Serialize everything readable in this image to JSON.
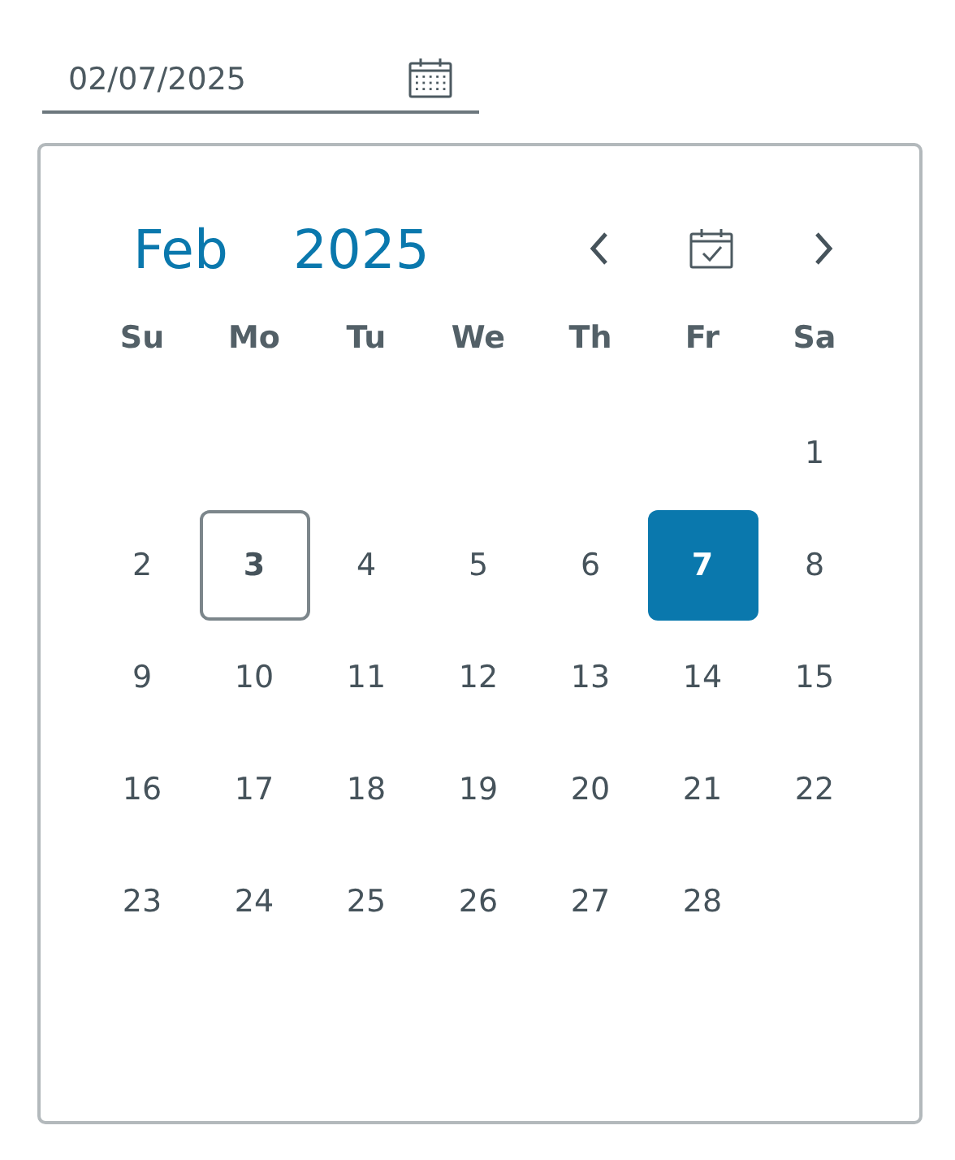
{
  "date_field": {
    "value": "02/07/2025"
  },
  "calendar": {
    "month": "Feb",
    "year": "2025",
    "weekdays": [
      "Su",
      "Mo",
      "Tu",
      "We",
      "Th",
      "Fr",
      "Sa"
    ],
    "weeks": [
      {
        "days": [
          {
            "label": "1",
            "selected": false,
            "today": false
          }
        ]
      },
      {
        "days": [
          {
            "label": "2",
            "selected": false,
            "today": false
          },
          {
            "label": "3",
            "selected": false,
            "today": true
          },
          {
            "label": "4",
            "selected": false,
            "today": false
          },
          {
            "label": "5",
            "selected": false,
            "today": false
          },
          {
            "label": "6",
            "selected": false,
            "today": false
          },
          {
            "label": "7",
            "selected": true,
            "today": false
          },
          {
            "label": "8",
            "selected": false,
            "today": false
          }
        ]
      },
      {
        "days": [
          {
            "label": "9",
            "selected": false,
            "today": false
          },
          {
            "label": "10",
            "selected": false,
            "today": false
          },
          {
            "label": "11",
            "selected": false,
            "today": false
          },
          {
            "label": "12",
            "selected": false,
            "today": false
          },
          {
            "label": "13",
            "selected": false,
            "today": false
          },
          {
            "label": "14",
            "selected": false,
            "today": false
          },
          {
            "label": "15",
            "selected": false,
            "today": false
          }
        ]
      },
      {
        "days": [
          {
            "label": "16",
            "selected": false,
            "today": false
          },
          {
            "label": "17",
            "selected": false,
            "today": false
          },
          {
            "label": "18",
            "selected": false,
            "today": false
          },
          {
            "label": "19",
            "selected": false,
            "today": false
          },
          {
            "label": "20",
            "selected": false,
            "today": false
          },
          {
            "label": "21",
            "selected": false,
            "today": false
          },
          {
            "label": "22",
            "selected": false,
            "today": false
          }
        ]
      },
      {
        "days": [
          {
            "label": "23",
            "selected": false,
            "today": false
          },
          {
            "label": "24",
            "selected": false,
            "today": false
          },
          {
            "label": "25",
            "selected": false,
            "today": false
          },
          {
            "label": "26",
            "selected": false,
            "today": false
          },
          {
            "label": "27",
            "selected": false,
            "today": false
          },
          {
            "label": "28",
            "selected": false,
            "today": false
          }
        ]
      }
    ]
  }
}
